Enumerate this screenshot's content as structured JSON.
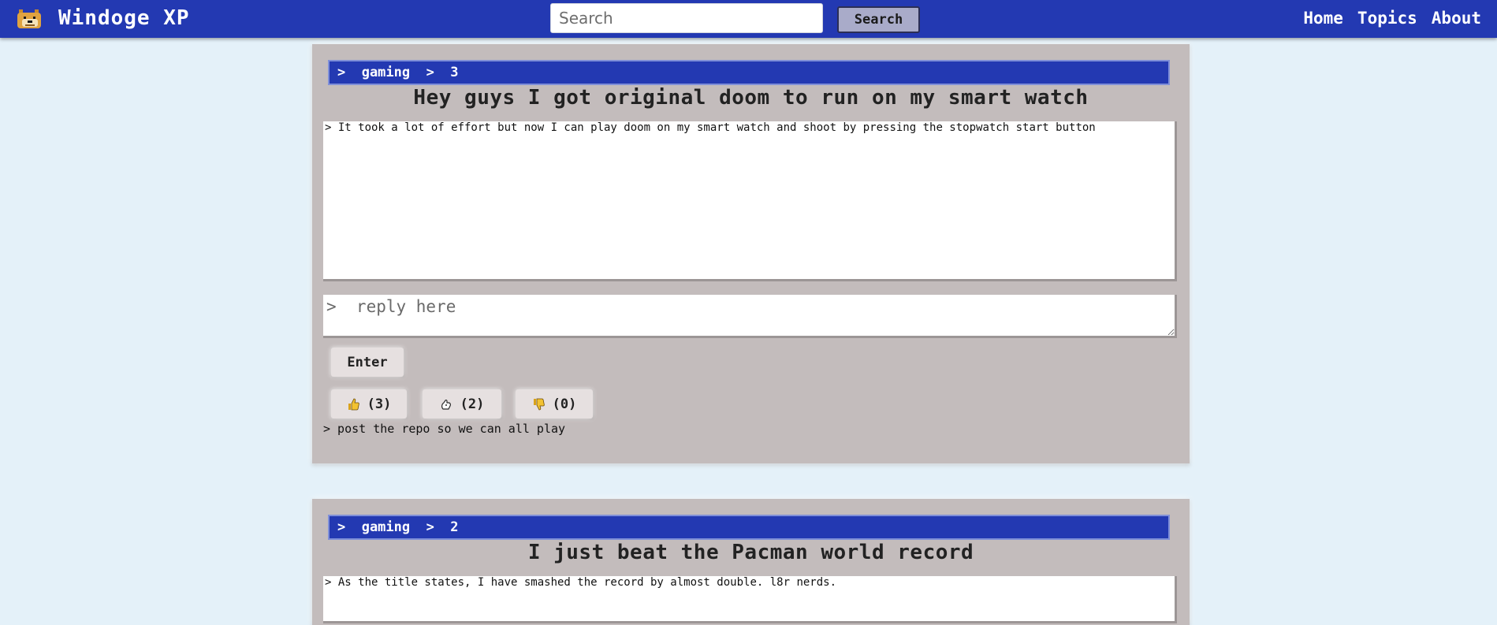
{
  "header": {
    "logo_alt": "doge-logo",
    "app_title": "Windoge XP",
    "search": {
      "placeholder": "Search",
      "value": ""
    },
    "search_button": "Search",
    "nav": [
      "Home",
      "Topics",
      "About"
    ]
  },
  "posts": [
    {
      "breadcrumb": ">  gaming  >  3",
      "title": "Hey guys I got original doom to run on my smart watch",
      "body": "> It took a lot of effort but now I can play doom on my smart watch and shoot by pressing the stopwatch start button",
      "reply_placeholder": ">  reply here",
      "enter_label": "Enter",
      "reactions": {
        "like": "(3)",
        "hmm": "(2)",
        "dislike": "(0)"
      },
      "comments": [
        "> post the repo so we can all play"
      ]
    },
    {
      "breadcrumb": ">  gaming  >  2",
      "title": "I just beat the Pacman world record",
      "body": "> As the title states, I have smashed the record by almost double. l8r nerds."
    }
  ],
  "colors": {
    "topbar": "#2339b2",
    "page_background": "#e4f1f9",
    "card_background": "#c3bcbc",
    "button_background": "#e6e0e0",
    "search_button": "#a9abc9"
  },
  "icons": {
    "logo": "doge-icon",
    "like": "thumbs-up-icon",
    "hmm": "thinking-hand-icon",
    "dislike": "thumbs-down-icon"
  }
}
